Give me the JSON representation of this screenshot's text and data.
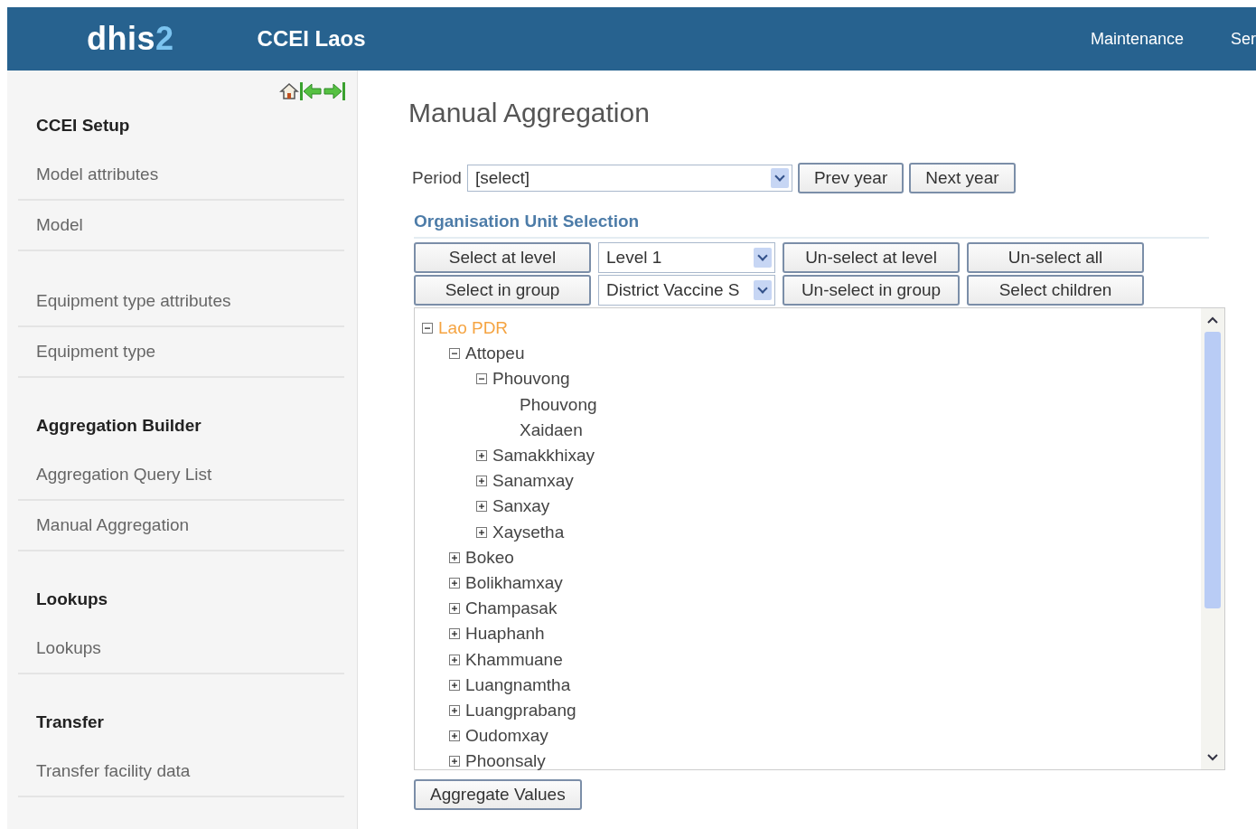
{
  "header": {
    "logo_main": "dhis",
    "logo_accent": "2",
    "app_title": "CCEI Laos",
    "menu": [
      "Maintenance",
      "Ser"
    ]
  },
  "sidebar": {
    "sections": [
      {
        "title": "CCEI Setup",
        "items": [
          "Model attributes",
          "Model"
        ]
      },
      {
        "items": [
          "Equipment type attributes",
          "Equipment type"
        ]
      },
      {
        "title": "Aggregation Builder",
        "items": [
          "Aggregation Query List",
          "Manual Aggregation"
        ]
      },
      {
        "title": "Lookups",
        "items": [
          "Lookups"
        ]
      },
      {
        "title": "Transfer",
        "items": [
          "Transfer facility data"
        ]
      }
    ]
  },
  "page_title": "Manual Aggregation",
  "period": {
    "label": "Period",
    "value": "[select]",
    "buttons": [
      "Prev year",
      "Next year"
    ]
  },
  "org_unit": {
    "title": "Organisation Unit Selection",
    "rows": [
      {
        "button": "Select at level",
        "select": "Level 1",
        "buttons": [
          "Un-select at level",
          "Un-select all"
        ]
      },
      {
        "button": "Select in group",
        "select": "District Vaccine S",
        "buttons": [
          "Un-select in group",
          "Select children"
        ]
      }
    ],
    "tree": [
      {
        "label": "Lao PDR",
        "expanded": true,
        "selected": true,
        "children": [
          {
            "label": "Attopeu",
            "expanded": true,
            "selected": false,
            "children": [
              {
                "label": "Phouvong",
                "expanded": true,
                "selected": false,
                "children": [
                  {
                    "label": "Phouvong",
                    "selected": false
                  },
                  {
                    "label": "Xaidaen",
                    "selected": false
                  }
                ]
              },
              {
                "label": "Samakkhixay",
                "expanded": false,
                "selected": false
              },
              {
                "label": "Sanamxay",
                "expanded": false,
                "selected": false
              },
              {
                "label": "Sanxay",
                "expanded": false,
                "selected": false
              },
              {
                "label": "Xaysetha",
                "expanded": false,
                "selected": false
              }
            ]
          },
          {
            "label": "Bokeo",
            "expanded": false,
            "selected": false
          },
          {
            "label": "Bolikhamxay",
            "expanded": false,
            "selected": false
          },
          {
            "label": "Champasak",
            "expanded": false,
            "selected": false
          },
          {
            "label": "Huaphanh",
            "expanded": false,
            "selected": false
          },
          {
            "label": "Khammuane",
            "expanded": false,
            "selected": false
          },
          {
            "label": "Luangnamtha",
            "expanded": false,
            "selected": false
          },
          {
            "label": "Luangprabang",
            "expanded": false,
            "selected": false
          },
          {
            "label": "Oudomxay",
            "expanded": false,
            "selected": false
          },
          {
            "label": "Phoonsaly",
            "expanded": false,
            "selected": false
          }
        ]
      }
    ]
  },
  "aggregate_button": "Aggregate Values"
}
